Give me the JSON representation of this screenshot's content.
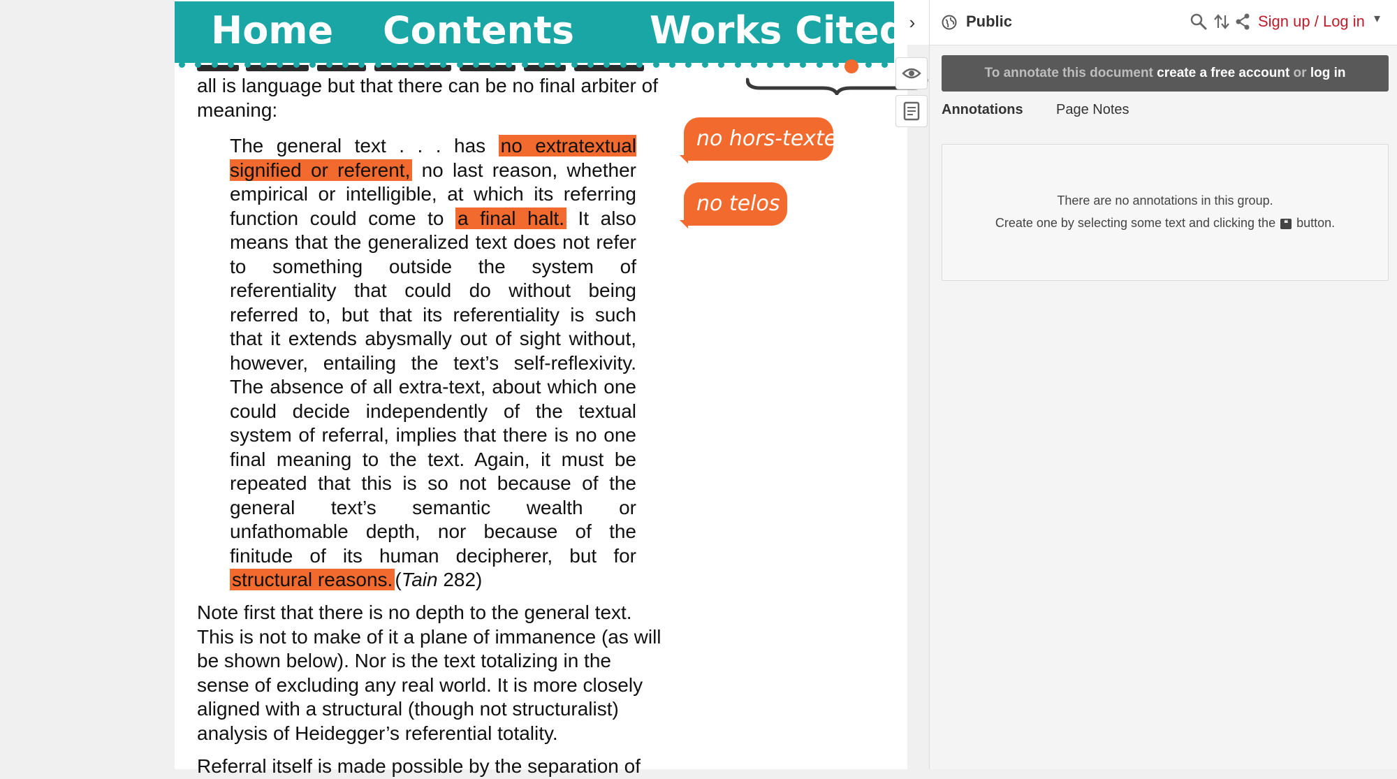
{
  "nav": {
    "home": "Home",
    "contents": "Contents",
    "works_cited": "Works Cited"
  },
  "document": {
    "paragraph_intro": "all is language but that there can be no final arbiter of meaning:",
    "quote": {
      "t1": "The general text . . . has ",
      "hl1": "no extratextual signified or referent,",
      "t2": " no last reason, whether empirical or intelligible, at which its referring function could come to ",
      "hl2": "a final halt.",
      "t3": " It also means that the generalized text does not refer to something outside the system of referentiality that could do without being referred to, but that its referentiality is such that it extends abysmally out of sight without, however, entailing the text’s self-reflexivity. The absence of all extra-text, about which one could decide independently of the textual system of referral, implies that there is no one final meaning to the text. Again, it must be repeated that this is so not because of the general text’s semantic wealth or unfathomable depth, nor because of the finitude of its human decipherer, but for ",
      "hl3": "structural reasons.",
      "cite_open": "(",
      "cite_title": "Tain",
      "cite_rest": " 282)"
    },
    "paragraph_after": "Note first that there is no depth to the general text. This is not to make of it a plane of immanence (as will be shown below). Nor is the text totalizing in the sense of excluding any real world. It is more closely aligned with a structural (though not structuralist) analysis of Heidegger’s referential totality.",
    "paragraph_cut": "Referral itself is made possible by the separation of"
  },
  "margin_notes": [
    "no hors-texte",
    "no telos"
  ],
  "sidebar": {
    "collapse_glyph": "›",
    "group_name": "Public",
    "auth_link": "Sign up / Log in",
    "auth_caret": "▾",
    "banner": {
      "prefix": "To annotate this document ",
      "create": "create a free account",
      "or": " or ",
      "login": "log in"
    },
    "tabs": {
      "annotations": "Annotations",
      "page_notes": "Page Notes"
    },
    "empty": {
      "line1": "There are no annotations in this group.",
      "line2_before": "Create one by selecting some text and clicking the ",
      "line2_after": " button."
    }
  },
  "colors": {
    "nav_teal": "#1ba6a6",
    "highlight_orange": "#f26a2e",
    "auth_red": "#bd1c2b",
    "banner_gray": "#595959"
  },
  "icons": {
    "group": "globe-icon",
    "search": "search-icon",
    "sort": "sort-icon",
    "share": "share-icon",
    "visibility": "eye-icon",
    "page_note": "page-note-icon",
    "annotate": "annotate-icon"
  }
}
